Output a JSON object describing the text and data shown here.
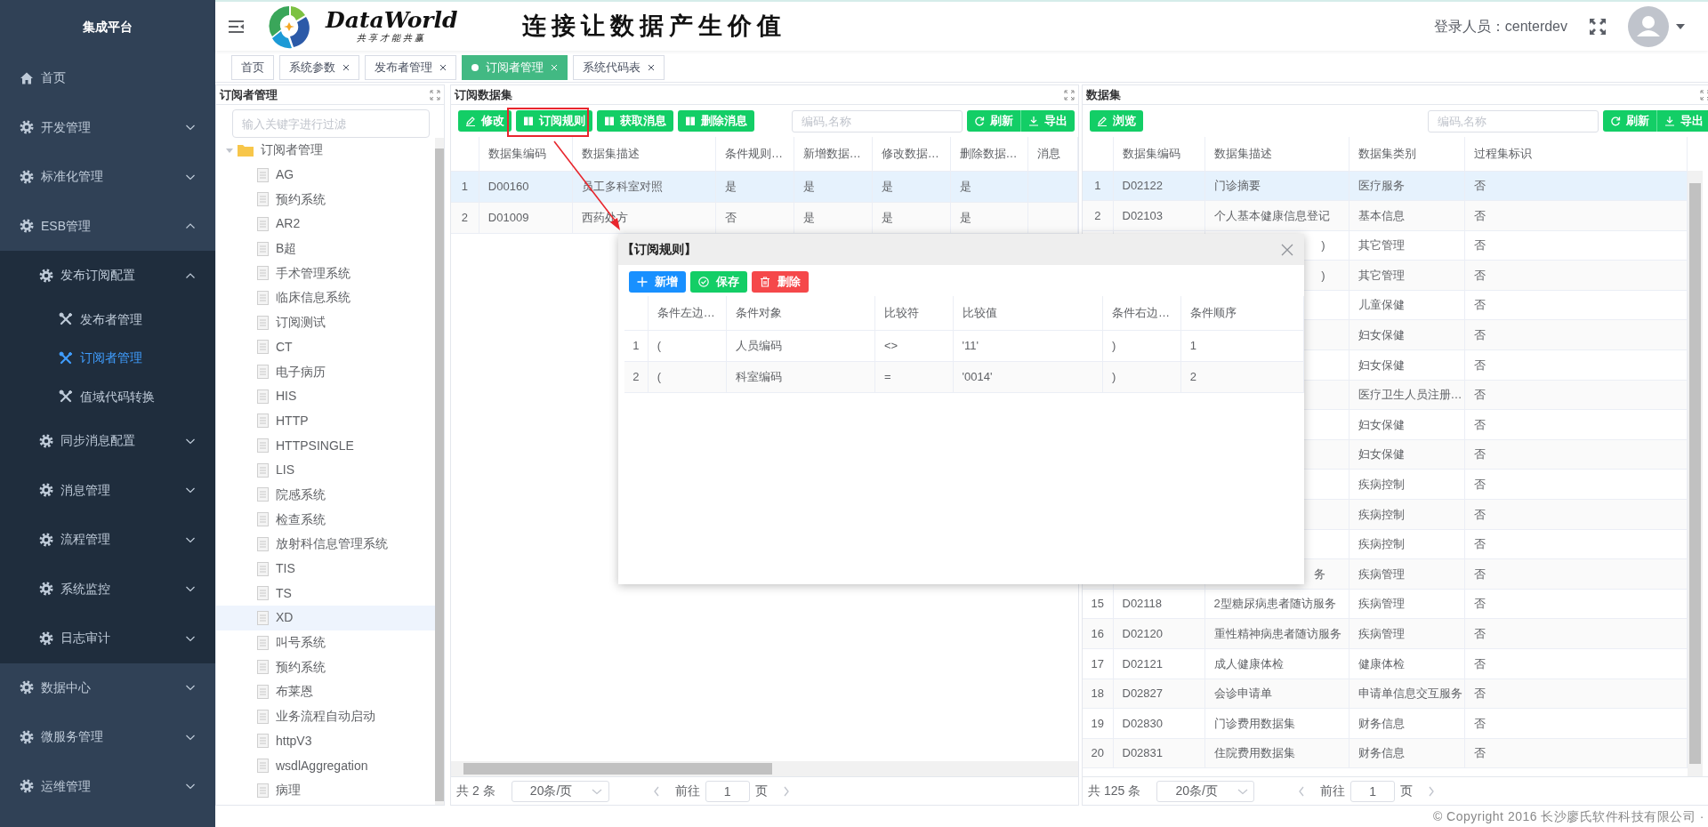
{
  "sidebar": {
    "title": "集成平台",
    "items": [
      {
        "label": "首页",
        "kind": "home"
      },
      {
        "label": "开发管理",
        "kind": "group",
        "expanded": false
      },
      {
        "label": "标准化管理",
        "kind": "group",
        "expanded": false
      },
      {
        "label": "ESB管理",
        "kind": "group",
        "expanded": true,
        "children": [
          {
            "label": "发布订阅配置",
            "kind": "group",
            "expanded": true,
            "children": [
              {
                "label": "发布者管理",
                "kind": "page",
                "selected": false
              },
              {
                "label": "订阅者管理",
                "kind": "page",
                "selected": true
              },
              {
                "label": "值域代码转换",
                "kind": "page",
                "selected": false
              }
            ]
          },
          {
            "label": "同步消息配置",
            "kind": "group",
            "expanded": false
          },
          {
            "label": "消息管理",
            "kind": "group",
            "expanded": false
          },
          {
            "label": "流程管理",
            "kind": "group",
            "expanded": false
          },
          {
            "label": "系统监控",
            "kind": "group",
            "expanded": false
          },
          {
            "label": "日志审计",
            "kind": "group",
            "expanded": false
          }
        ]
      },
      {
        "label": "数据中心",
        "kind": "group",
        "expanded": false
      },
      {
        "label": "微服务管理",
        "kind": "group",
        "expanded": false
      },
      {
        "label": "运维管理",
        "kind": "group",
        "expanded": false
      }
    ]
  },
  "header": {
    "brand": "DataWorld",
    "tagline": "共享才能共赢",
    "slogan": "连接让数据产生价值",
    "user": "登录人员：centerdev"
  },
  "tabs": [
    {
      "label": "首页",
      "closable": false,
      "selected": false
    },
    {
      "label": "系统参数",
      "closable": true,
      "selected": false
    },
    {
      "label": "发布者管理",
      "closable": true,
      "selected": false
    },
    {
      "label": "订阅者管理",
      "closable": true,
      "selected": true
    },
    {
      "label": "系统代码表",
      "closable": true,
      "selected": false
    }
  ],
  "subscriber_panel": {
    "title": "订阅者管理",
    "filter": {
      "placeholder": "输入关键字进行过滤"
    },
    "tree": [
      {
        "label": "订阅者管理",
        "expanded": true,
        "selected": false,
        "children": [
          {
            "label": "AG",
            "selected": false
          },
          {
            "label": "预约系统",
            "selected": false
          },
          {
            "label": "AR2",
            "selected": false
          },
          {
            "label": "B超",
            "selected": false
          },
          {
            "label": "手术管理系统",
            "selected": false
          },
          {
            "label": "临床信息系统",
            "selected": false
          },
          {
            "label": "订阅测试",
            "selected": false
          },
          {
            "label": "CT",
            "selected": false
          },
          {
            "label": "电子病历",
            "selected": false
          },
          {
            "label": "HIS",
            "selected": false
          },
          {
            "label": "HTTP",
            "selected": false
          },
          {
            "label": "HTTPSINGLE",
            "selected": false
          },
          {
            "label": "LIS",
            "selected": false
          },
          {
            "label": "院感系统",
            "selected": false
          },
          {
            "label": "检查系统",
            "selected": false
          },
          {
            "label": "放射科信息管理系统",
            "selected": false
          },
          {
            "label": "TIS",
            "selected": false
          },
          {
            "label": "TS",
            "selected": false
          },
          {
            "label": "XD",
            "selected": true
          },
          {
            "label": "叫号系统",
            "selected": false
          },
          {
            "label": "预约系统",
            "selected": false
          },
          {
            "label": "布莱恩",
            "selected": false
          },
          {
            "label": "业务流程自动启动",
            "selected": false
          },
          {
            "label": "httpV3",
            "selected": false
          },
          {
            "label": "wsdlAggregation",
            "selected": false
          },
          {
            "label": "病理",
            "selected": false
          }
        ]
      }
    ]
  },
  "subscribed_datasets": {
    "title": "订阅数据集",
    "buttons": [
      {
        "label": "修改",
        "kind": "edit"
      },
      {
        "label": "订阅规则",
        "kind": "book"
      },
      {
        "label": "获取消息",
        "kind": "book"
      },
      {
        "label": "删除消息",
        "kind": "book"
      }
    ],
    "search": {
      "placeholder": "编码,名称"
    },
    "actions": [
      {
        "label": "刷新",
        "kind": "refresh"
      },
      {
        "label": "导出",
        "kind": "export"
      }
    ],
    "columns": [
      "数据集编码",
      "数据集描述",
      "条件规则…",
      "新增数据…",
      "修改数据…",
      "删除数据…",
      "消息"
    ],
    "rows": [
      {
        "index": "1",
        "selected": true,
        "cells": [
          "D00160",
          "员工多科室对照",
          "是",
          "是",
          "是",
          "是"
        ]
      },
      {
        "index": "2",
        "selected": false,
        "cells": [
          "D01009",
          "西药处方",
          "否",
          "是",
          "是",
          "是"
        ]
      }
    ],
    "pagination": {
      "total": "共 2 条",
      "page_size": "20条/页",
      "goto": "前往",
      "page": "1",
      "page_suffix": "页"
    }
  },
  "datasets": {
    "title": "数据集",
    "buttons": [
      {
        "label": "浏览",
        "kind": "edit"
      }
    ],
    "search": {
      "placeholder": "编码,名称"
    },
    "actions": [
      {
        "label": "刷新",
        "kind": "refresh"
      },
      {
        "label": "导出",
        "kind": "export"
      }
    ],
    "columns": [
      "数据集编码",
      "数据集描述",
      "数据集类别",
      "过程集标识"
    ],
    "rows": [
      {
        "index": "1",
        "code": "D02122",
        "description": "门诊摘要",
        "category": "医疗服务",
        "flag": "否",
        "selected": true
      },
      {
        "index": "2",
        "code": "D02103",
        "description": "个人基本健康信息登记",
        "category": "基本信息",
        "flag": "否",
        "selected": false
      },
      {
        "description": ")",
        "category": "其它管理",
        "flag": "否",
        "selected": false
      },
      {
        "description": ")",
        "category": "其它管理",
        "flag": "否",
        "selected": false
      },
      {
        "category": "儿童保健",
        "flag": "否",
        "selected": false
      },
      {
        "category": "妇女保健",
        "flag": "否",
        "selected": false
      },
      {
        "category": "妇女保健",
        "flag": "否",
        "selected": false
      },
      {
        "category": "医疗卫生人员注册…",
        "flag": "否",
        "selected": false
      },
      {
        "category": "妇女保健",
        "flag": "否",
        "selected": false
      },
      {
        "category": "妇女保健",
        "flag": "否",
        "selected": false
      },
      {
        "category": "疾病控制",
        "flag": "否",
        "selected": false
      },
      {
        "category": "疾病控制",
        "flag": "否",
        "selected": false
      },
      {
        "category": "疾病控制",
        "flag": "否",
        "selected": false
      },
      {
        "description": "务",
        "category": "疾病管理",
        "flag": "否",
        "selected": false
      },
      {
        "index": "15",
        "code": "D02118",
        "description": "2型糖尿病患者随访服务",
        "category": "疾病管理",
        "flag": "否",
        "selected": false
      },
      {
        "index": "16",
        "code": "D02120",
        "description": "重性精神病患者随访服务",
        "category": "疾病管理",
        "flag": "否",
        "selected": false
      },
      {
        "index": "17",
        "code": "D02121",
        "description": "成人健康体检",
        "category": "健康体检",
        "flag": "否",
        "selected": false
      },
      {
        "index": "18",
        "code": "D02827",
        "description": "会诊申请单",
        "category": "申请单信息交互服务",
        "flag": "否",
        "selected": false
      },
      {
        "index": "19",
        "code": "D02830",
        "description": "门诊费用数据集",
        "category": "财务信息",
        "flag": "否",
        "selected": false
      },
      {
        "index": "20",
        "code": "D02831",
        "description": "住院费用数据集",
        "category": "财务信息",
        "flag": "否",
        "selected": false
      }
    ],
    "pagination": {
      "total": "共 125 条",
      "page_size": "20条/页",
      "goto": "前往",
      "page": "1",
      "page_suffix": "页"
    }
  },
  "dialog": {
    "title": "【订阅规则】",
    "buttons": [
      {
        "label": "新增",
        "kind": "add"
      },
      {
        "label": "保存",
        "kind": "save"
      },
      {
        "label": "删除",
        "kind": "delete"
      }
    ],
    "columns": [
      "条件左边…",
      "条件对象",
      "比较符",
      "比较值",
      "条件右边…",
      "条件顺序"
    ],
    "rows": [
      {
        "index": "1",
        "cells": [
          "(",
          "人员编码",
          "<>",
          "'11'",
          ")",
          "1"
        ]
      },
      {
        "index": "2",
        "cells": [
          "(",
          "科室编码",
          "=",
          "'0014'",
          ")",
          "2"
        ]
      }
    ]
  },
  "footer": {
    "copyright": "© Copyright 2016 长沙廖氏软件科技有限公司 ·"
  }
}
